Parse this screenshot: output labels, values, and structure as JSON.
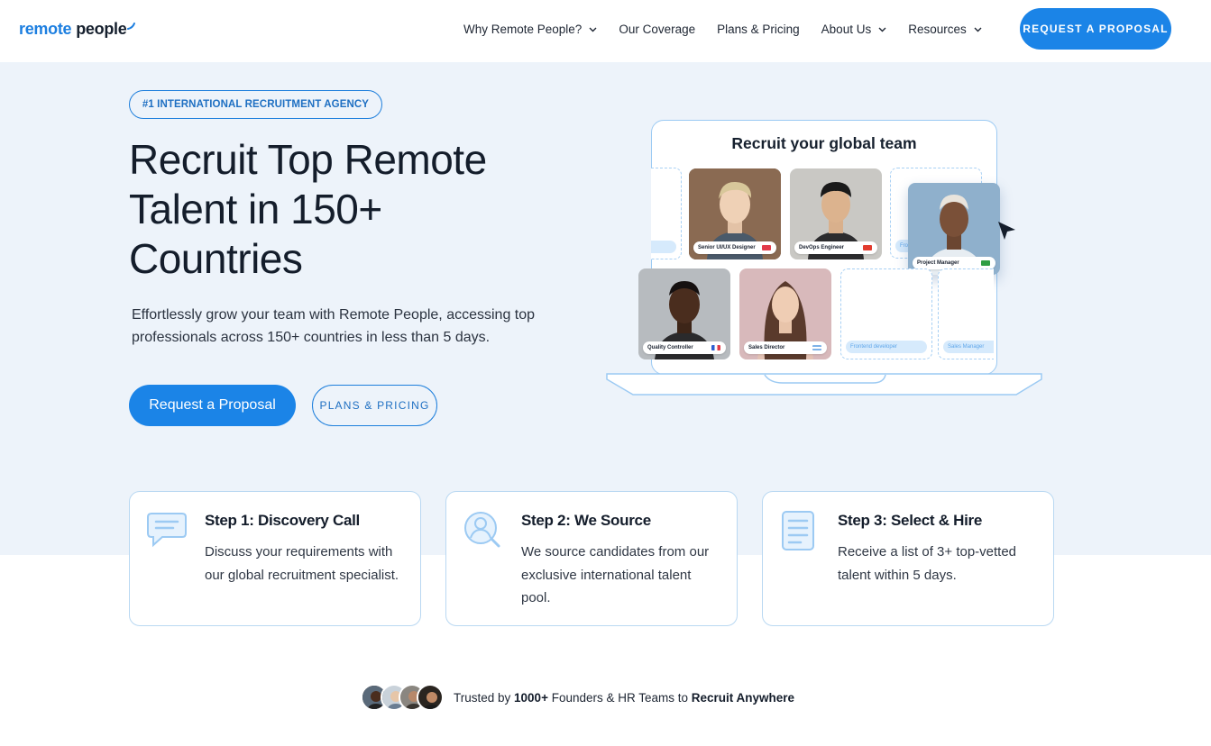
{
  "nav": {
    "logo_part1": "remote",
    "logo_part2": "people",
    "items": [
      {
        "label": "Why Remote People?",
        "dropdown": true
      },
      {
        "label": "Our Coverage",
        "dropdown": false
      },
      {
        "label": "Plans & Pricing",
        "dropdown": false
      },
      {
        "label": "About Us",
        "dropdown": true
      },
      {
        "label": "Resources",
        "dropdown": true
      }
    ],
    "cta": "REQUEST A PROPOSAL"
  },
  "hero": {
    "badge": "#1 INTERNATIONAL RECRUITMENT AGENCY",
    "title": "Recruit Top Remote Talent in 150+ Countries",
    "lead": "Effortlessly grow your team with Remote People, accessing top professionals across 150+ countries in less than 5 days.",
    "primary_button": "Request a Proposal",
    "secondary_button": "PLANS & PRICING"
  },
  "illustration": {
    "title": "Recruit your global team",
    "cards": [
      {
        "role": "Senior UI/UX Designer",
        "flag_color": "#e23b4a"
      },
      {
        "role": "DevOps Engineer",
        "flag_color": "#e23b2e"
      },
      {
        "role": "Project Manager",
        "flag_color": "#2f9e44"
      },
      {
        "role": "Quality Controller",
        "flag_color": "#2f5fd0"
      },
      {
        "role": "Sales Director",
        "flag_color": "#7fb2e8"
      },
      {
        "role": "Frontend developer",
        "flag_color": ""
      },
      {
        "role": "Sales Manager",
        "flag_color": ""
      }
    ],
    "partial_card_label": "Fro"
  },
  "steps": [
    {
      "title": "Step 1: Discovery Call",
      "description": "Discuss your requirements with our global recruitment specialist.",
      "icon": "chat-bubble-icon"
    },
    {
      "title": "Step 2: We Source",
      "description": "We source candidates from our exclusive international talent pool.",
      "icon": "user-search-icon"
    },
    {
      "title": "Step 3: Select & Hire",
      "description": "Receive a list of 3+ top-vetted talent within 5 days.",
      "icon": "document-list-icon"
    }
  ],
  "trust": {
    "prefix": "Trusted by ",
    "count": "1000+",
    "middle": " Founders & HR Teams to ",
    "emphasis": "Recruit Anywhere"
  },
  "colors": {
    "accent": "#1b84e7",
    "hero_bg": "#edf3fa",
    "card_border": "#b9d8f2"
  }
}
